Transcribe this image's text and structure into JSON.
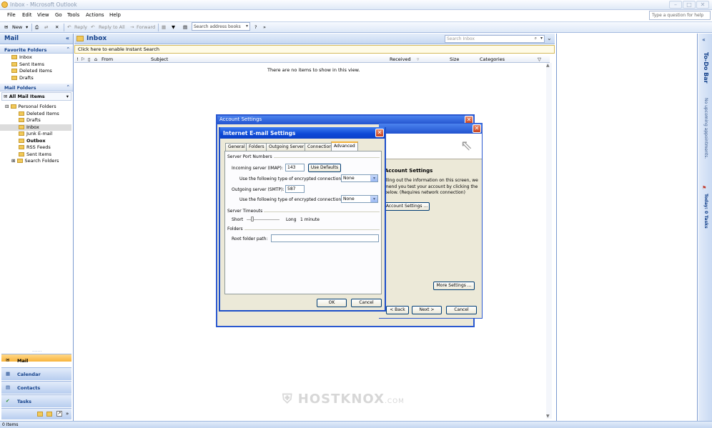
{
  "window": {
    "title": "Inbox - Microsoft Outlook"
  },
  "menu": [
    "File",
    "Edit",
    "View",
    "Go",
    "Tools",
    "Actions",
    "Help"
  ],
  "ask": {
    "placeholder": "Type a question for help"
  },
  "toolbar": {
    "new": "New",
    "reply": "Reply",
    "reply_all": "Reply to All",
    "forward": "Forward",
    "address_placeholder": "Search address books"
  },
  "nav": {
    "title": "Mail",
    "favorites_header": "Favorite Folders",
    "favorites": [
      "Inbox",
      "Sent Items",
      "Deleted Items",
      "Drafts"
    ],
    "mail_folders_header": "Mail Folders",
    "all_mail": "All Mail Items",
    "tree_root": "Personal Folders",
    "tree": [
      "Deleted Items",
      "Drafts",
      "Inbox",
      "Junk E-mail",
      "Outbox",
      "RSS Feeds",
      "Sent Items",
      "Search Folders"
    ],
    "buttons": [
      "Mail",
      "Calendar",
      "Contacts",
      "Tasks"
    ]
  },
  "main": {
    "title": "Inbox",
    "search_placeholder": "Search Inbox",
    "instant_search": "Click here to enable Instant Search",
    "columns": [
      "From",
      "Subject",
      "Received",
      "Size",
      "Categories"
    ],
    "empty_text": "There are no items to show in this view."
  },
  "todo": {
    "title": "To-Do Bar",
    "appointments": "No upcoming appointments.",
    "tasks": "Today: 0 Tasks"
  },
  "status": {
    "items": "0 Items"
  },
  "account_settings": {
    "title": "Account Settings",
    "heading": "Account Settings",
    "line1": "illing out the information on this screen, we",
    "line2": "mend you test your account by clicking the",
    "line3": "below. (Requires network connection)",
    "test_button": "Account Settings ...",
    "more_settings": "More Settings ...",
    "back": "< Back",
    "next": "Next >",
    "cancel": "Cancel"
  },
  "email_settings": {
    "title": "Internet E-mail Settings",
    "tabs": [
      "General",
      "Folders",
      "Outgoing Server",
      "Connection",
      "Advanced"
    ],
    "server_ports": "Server Port Numbers",
    "incoming_label": "Incoming server (IMAP):",
    "incoming_value": "143",
    "use_defaults": "Use Defaults",
    "enc_label": "Use the following type of encrypted connection:",
    "enc_value_in": "None",
    "outgoing_label": "Outgoing server (SMTP):",
    "outgoing_value": "587",
    "enc_value_out": "None",
    "timeouts": "Server Timeouts",
    "short": "Short",
    "long": "Long",
    "timeout_value": "1 minute",
    "folders": "Folders",
    "root_label": "Root folder path:",
    "root_value": "",
    "ok": "OK",
    "cancel": "Cancel"
  },
  "watermark": {
    "brand": "HOSTKNOX",
    "tld": ".COM"
  }
}
